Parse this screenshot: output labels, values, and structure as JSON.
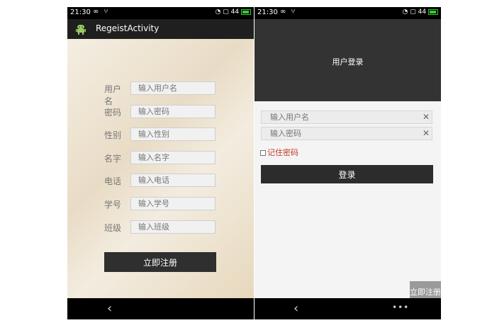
{
  "left_phone": {
    "status": {
      "time": "21:30",
      "battery": "44"
    },
    "app_title": "RegeistActivity",
    "fields": [
      {
        "label": "用户名",
        "placeholder": "输入用户名"
      },
      {
        "label": "密码",
        "placeholder": "输入密码"
      },
      {
        "label": "性别",
        "placeholder": "输入性别"
      },
      {
        "label": "名字",
        "placeholder": "输入名字"
      },
      {
        "label": "电话",
        "placeholder": "输入电话"
      },
      {
        "label": "学号",
        "placeholder": "输入学号"
      },
      {
        "label": "班级",
        "placeholder": "输入班级"
      }
    ],
    "register_button": "立即注册",
    "nav_back": "‹"
  },
  "right_phone": {
    "status": {
      "time": "21:30",
      "battery": "44"
    },
    "header_title": "用户登录",
    "username_placeholder": "输入用户名",
    "password_placeholder": "输入密码",
    "clear_glyph": "✕",
    "remember_label": "记住密码",
    "login_button": "登录",
    "register_button": "立即注册",
    "nav_back": "‹",
    "nav_menu": "•••"
  }
}
